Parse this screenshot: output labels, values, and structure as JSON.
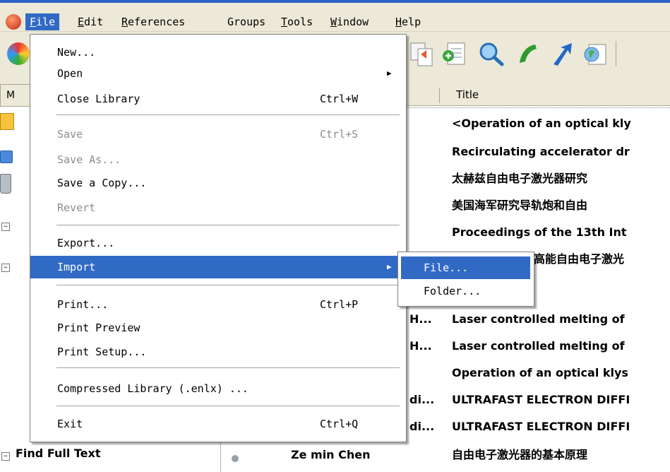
{
  "menubar": {
    "items": [
      "File",
      "Edit",
      "References",
      "Groups",
      "Tools",
      "Window",
      "Help"
    ]
  },
  "file_menu": {
    "new": "New...",
    "open": "Open",
    "close": "Close Library",
    "close_sc": "Ctrl+W",
    "save": "Save",
    "save_sc": "Ctrl+S",
    "save_as": "Save As...",
    "save_copy": "Save a Copy...",
    "revert": "Revert",
    "export": "Export...",
    "import": "Import",
    "print": "Print...",
    "print_sc": "Ctrl+P",
    "print_preview": "Print Preview",
    "print_setup": "Print Setup...",
    "compressed": "Compressed Library (.enlx) ...",
    "exit": "Exit",
    "exit_sc": "Ctrl+Q"
  },
  "import_submenu": {
    "file": "File...",
    "folder": "Folder..."
  },
  "left_pane": {
    "header": "M",
    "find_full_text": "Find Full Text"
  },
  "list": {
    "title_header": "Title",
    "rows": [
      {
        "author": "",
        "title": "<Operation of an optical kly"
      },
      {
        "author": "",
        "title": "Recirculating accelerator dr"
      },
      {
        "author": "",
        "title": "太赫兹自由电子激光器研究"
      },
      {
        "author": "",
        "title": "美国海军研究导轨炮和自由"
      },
      {
        "author": "",
        "title": "Proceedings of the 13th Int"
      },
      {
        "author": "",
        "title": "高能自由电子激光"
      },
      {
        "author": "",
        "title": ""
      },
      {
        "author": "H...",
        "title": "Laser controlled melting of"
      },
      {
        "author": "H...",
        "title": "Laser controlled melting of"
      },
      {
        "author": "",
        "title": "Operation of an optical klys"
      },
      {
        "author": "di...",
        "title": "ULTRAFAST ELECTRON DIFFI"
      },
      {
        "author": "di...",
        "title": "ULTRAFAST ELECTRON DIFFI"
      },
      {
        "author": "Ze min Chen",
        "title": "自由电子激光器的基本原理"
      }
    ]
  },
  "colors": {
    "menu_highlight": "#316ac5",
    "chrome": "#ece9d8"
  }
}
